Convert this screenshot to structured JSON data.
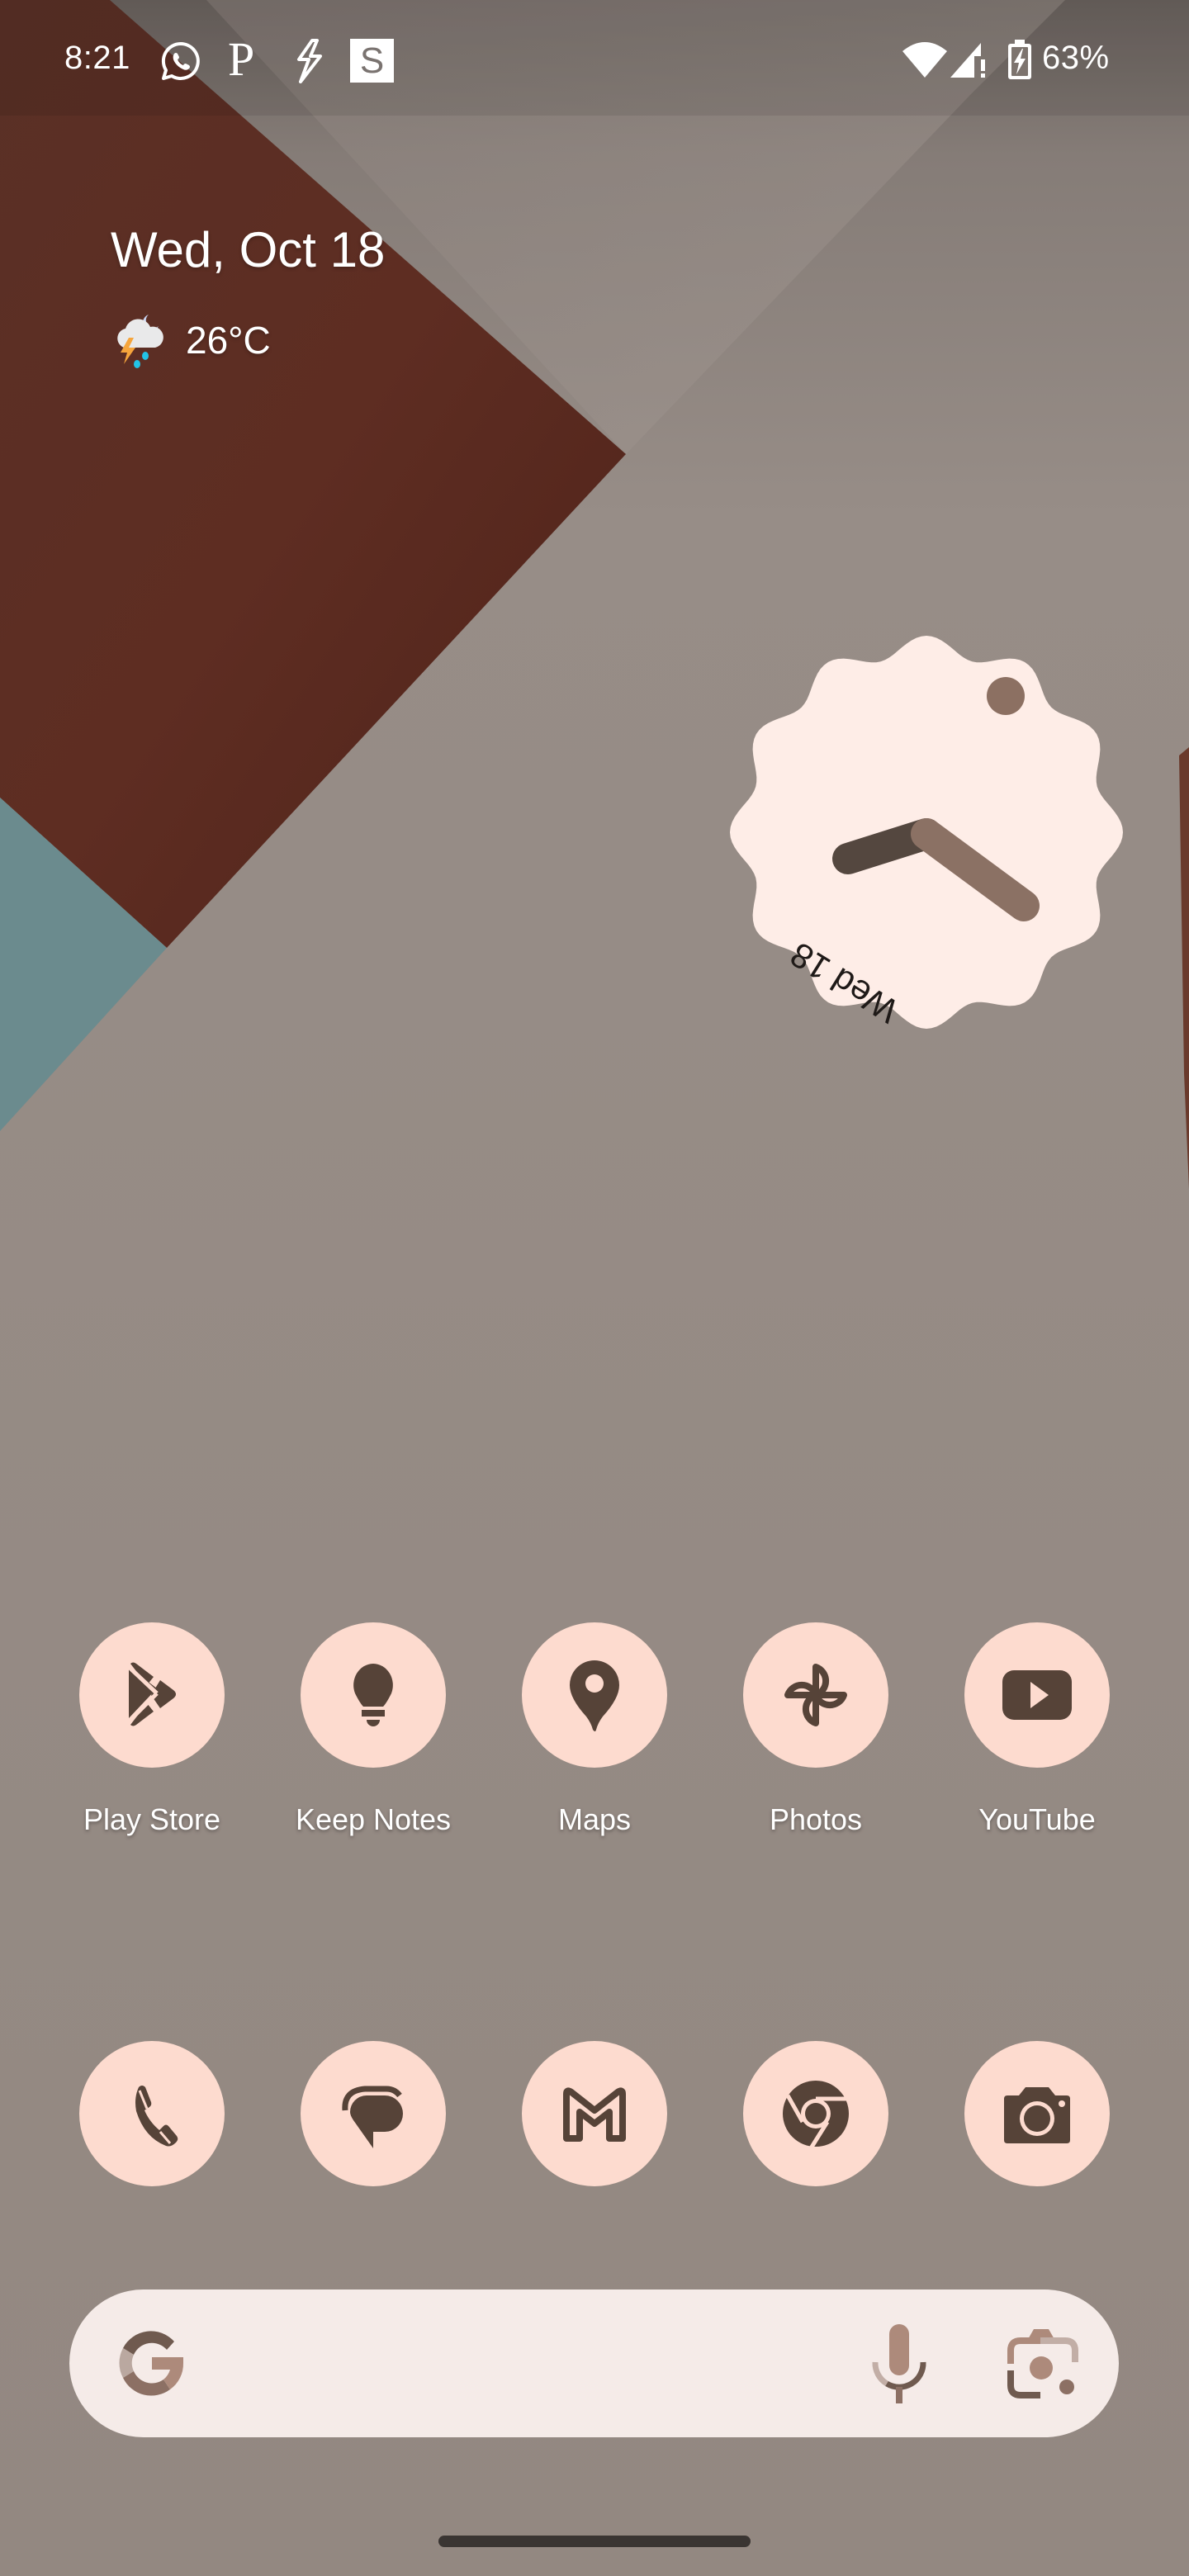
{
  "status_bar": {
    "time": "8:21",
    "notification_icons": [
      "whatsapp-icon",
      "p-app-icon",
      "bolt-app-icon",
      "s-app-icon"
    ],
    "s_app_letter": "S",
    "p_app_letter": "P",
    "system_icons": [
      "wifi-icon",
      "cell-signal-no-data-icon",
      "battery-charging-icon"
    ],
    "battery_percent": "63%"
  },
  "at_a_glance": {
    "date": "Wed, Oct 18",
    "weather_icon": "thunderstorm-night-icon",
    "temperature": "26°C"
  },
  "clock_widget": {
    "date_label": "Wed 18",
    "time": "8:21"
  },
  "apps": [
    {
      "label": "Play Store",
      "icon": "play-store-icon"
    },
    {
      "label": "Keep Notes",
      "icon": "keep-notes-icon"
    },
    {
      "label": "Maps",
      "icon": "maps-icon"
    },
    {
      "label": "Photos",
      "icon": "photos-icon"
    },
    {
      "label": "YouTube",
      "icon": "youtube-icon"
    }
  ],
  "dock": [
    {
      "name": "Phone",
      "icon": "phone-icon"
    },
    {
      "name": "Messages",
      "icon": "messages-icon"
    },
    {
      "name": "Gmail",
      "icon": "gmail-icon"
    },
    {
      "name": "Chrome",
      "icon": "chrome-icon"
    },
    {
      "name": "Camera",
      "icon": "camera-icon"
    }
  ],
  "search_bar": {
    "logo": "google-g-icon",
    "voice": "mic-icon",
    "lens": "lens-icon"
  },
  "theme": {
    "icon_background": "#fddbcf",
    "icon_foreground": "#564338",
    "search_background": "#f5ebe8",
    "clock_face": "#feede7",
    "accent_brown": "#8c7064"
  }
}
